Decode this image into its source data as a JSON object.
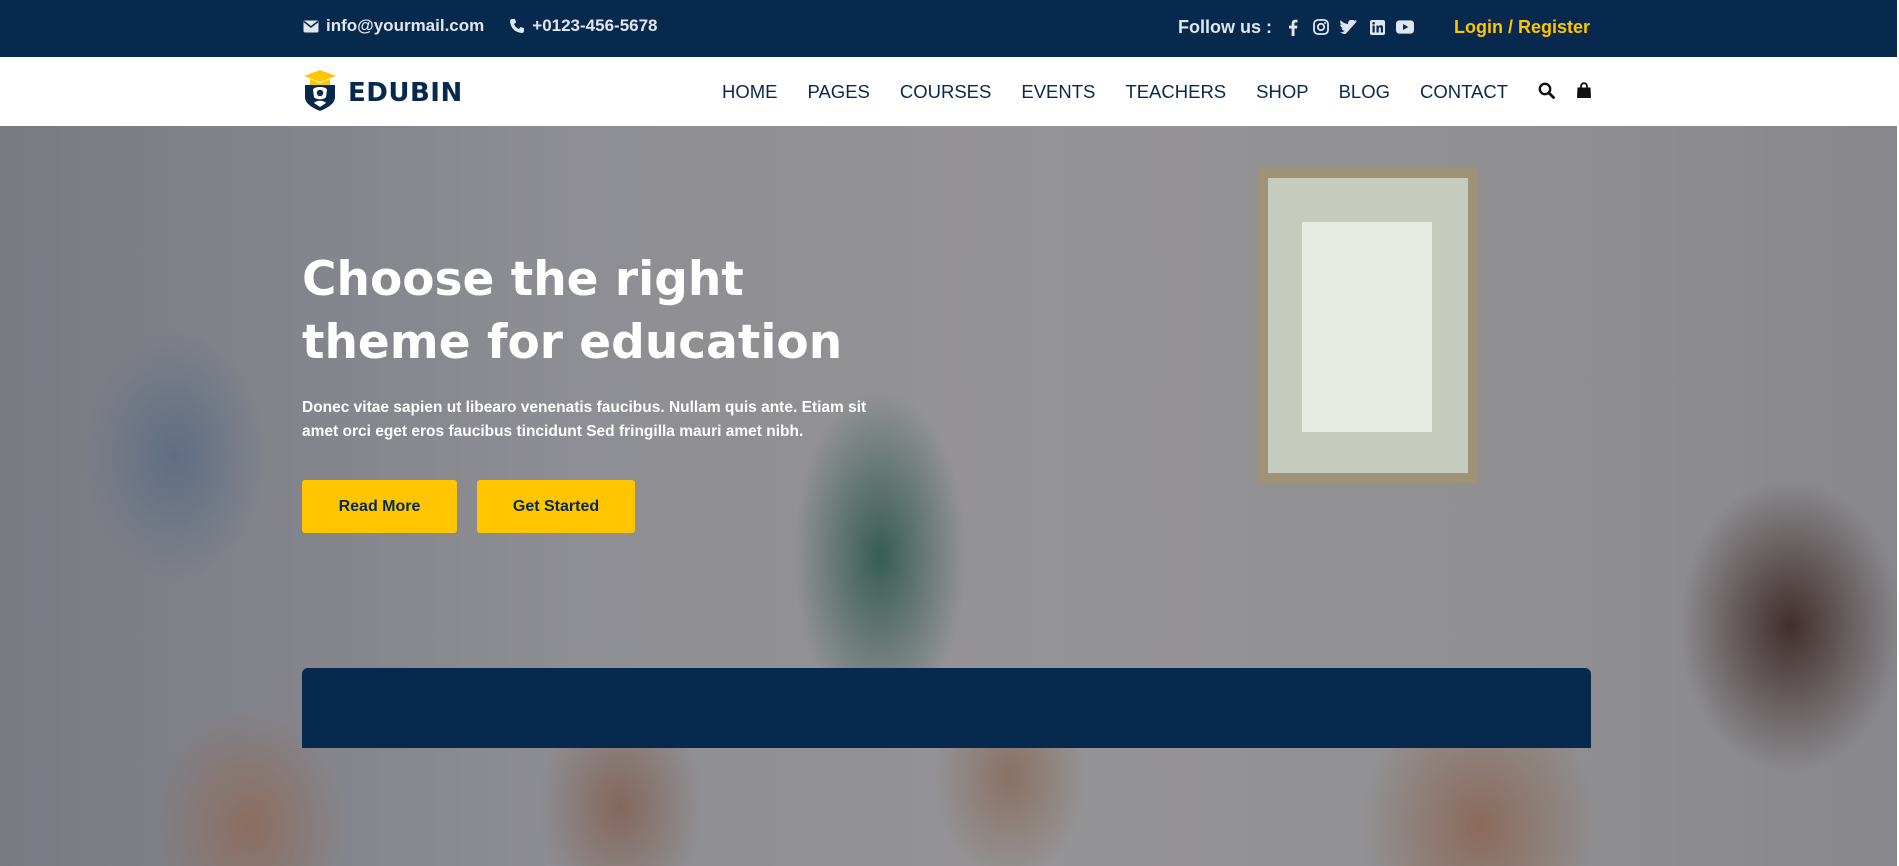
{
  "topbar": {
    "email": "info@yourmail.com",
    "phone": "+0123-456-5678",
    "follow_label": "Follow us :",
    "socials": [
      "facebook-icon",
      "instagram-icon",
      "twitter-icon",
      "linkedin-icon",
      "youtube-icon"
    ],
    "login_label": "Login / Register"
  },
  "header": {
    "logo_text": "EDUBIN",
    "nav": [
      "HOME",
      "PAGES",
      "COURSES",
      "EVENTS",
      "TEACHERS",
      "SHOP",
      "BLOG",
      "CONTACT"
    ],
    "icons": [
      "search-icon",
      "shopping-bag-icon"
    ]
  },
  "hero": {
    "title": "Choose the right theme for education",
    "description": "Donec vitae sapien ut libearo venenatis faucibus. Nullam quis ante. Etiam sit amet orci eget eros faucibus tincidunt Sed fringilla mauri amet nibh.",
    "btn_read_more": "Read More",
    "btn_get_started": "Get Started"
  },
  "colors": {
    "primary": "#07294d",
    "accent": "#ffc600",
    "white": "#ffffff"
  }
}
